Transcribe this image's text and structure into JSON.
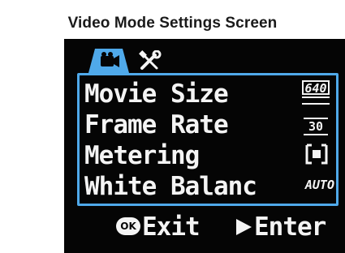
{
  "caption": "Video Mode Settings Screen",
  "tabs": [
    {
      "icon": "film-camera-icon",
      "active": true
    },
    {
      "icon": "tools-icon",
      "active": false
    }
  ],
  "menu": {
    "items": [
      {
        "label": "Movie Size",
        "value": "640"
      },
      {
        "label": "Frame Rate",
        "value": "30"
      },
      {
        "label": "Metering",
        "value_icon": "center-spot-metering-icon"
      },
      {
        "label": "White Balanc",
        "value": "AUTO"
      }
    ]
  },
  "footer": {
    "ok_label": "OK",
    "exit_label": "Exit",
    "enter_label": "Enter"
  },
  "colors": {
    "screen_bg": "#050505",
    "text": "#f4f4f4",
    "menu_border": "#4fa9ea",
    "tab_active": "#4fa9ea"
  }
}
